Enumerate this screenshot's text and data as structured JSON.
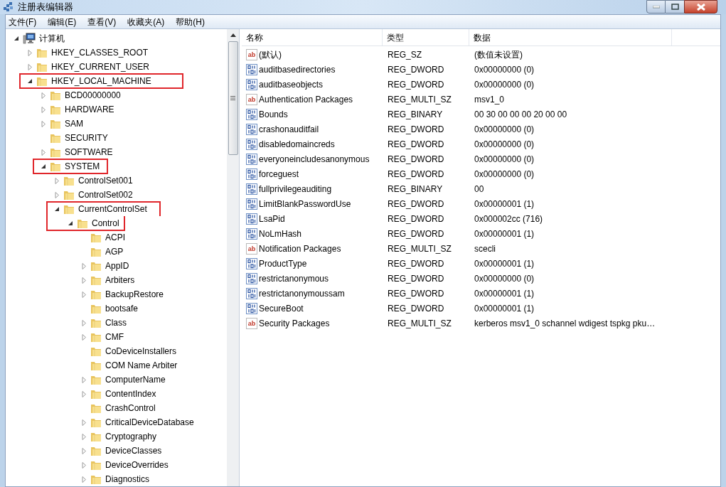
{
  "window": {
    "title": "注册表编辑器"
  },
  "menu": [
    "文件(F)",
    "编辑(E)",
    "查看(V)",
    "收藏夹(A)",
    "帮助(H)"
  ],
  "tree": [
    {
      "label": "计算机",
      "kind": "computer",
      "expandable": true,
      "expanded": true,
      "highlighted": false,
      "children": [
        {
          "label": "HKEY_CLASSES_ROOT",
          "expandable": true,
          "expanded": false,
          "highlighted": false
        },
        {
          "label": "HKEY_CURRENT_USER",
          "expandable": true,
          "expanded": false,
          "highlighted": false
        },
        {
          "label": "HKEY_LOCAL_MACHINE",
          "expandable": true,
          "expanded": true,
          "highlighted": true,
          "children": [
            {
              "label": "BCD00000000",
              "expandable": true,
              "expanded": false,
              "highlighted": false
            },
            {
              "label": "HARDWARE",
              "expandable": true,
              "expanded": false,
              "highlighted": false
            },
            {
              "label": "SAM",
              "expandable": true,
              "expanded": false,
              "highlighted": false
            },
            {
              "label": "SECURITY",
              "expandable": false,
              "expanded": false,
              "highlighted": false
            },
            {
              "label": "SOFTWARE",
              "expandable": true,
              "expanded": false,
              "highlighted": false
            },
            {
              "label": "SYSTEM",
              "expandable": true,
              "expanded": true,
              "highlighted": true,
              "children": [
                {
                  "label": "ControlSet001",
                  "expandable": true,
                  "expanded": false,
                  "highlighted": false
                },
                {
                  "label": "ControlSet002",
                  "expandable": true,
                  "expanded": false,
                  "highlighted": false
                },
                {
                  "label": "CurrentControlSet",
                  "expandable": true,
                  "expanded": true,
                  "highlighted": true,
                  "children": [
                    {
                      "label": "Control",
                      "expandable": true,
                      "expanded": true,
                      "highlighted": true,
                      "children": [
                        {
                          "label": "ACPI",
                          "expandable": false,
                          "expanded": false,
                          "highlighted": false
                        },
                        {
                          "label": "AGP",
                          "expandable": false,
                          "expanded": false,
                          "highlighted": false
                        },
                        {
                          "label": "AppID",
                          "expandable": true,
                          "expanded": false,
                          "highlighted": false
                        },
                        {
                          "label": "Arbiters",
                          "expandable": true,
                          "expanded": false,
                          "highlighted": false
                        },
                        {
                          "label": "BackupRestore",
                          "expandable": true,
                          "expanded": false,
                          "highlighted": false
                        },
                        {
                          "label": "bootsafe",
                          "expandable": false,
                          "expanded": false,
                          "highlighted": false
                        },
                        {
                          "label": "Class",
                          "expandable": true,
                          "expanded": false,
                          "highlighted": false
                        },
                        {
                          "label": "CMF",
                          "expandable": true,
                          "expanded": false,
                          "highlighted": false
                        },
                        {
                          "label": "CoDeviceInstallers",
                          "expandable": false,
                          "expanded": false,
                          "highlighted": false
                        },
                        {
                          "label": "COM Name Arbiter",
                          "expandable": false,
                          "expanded": false,
                          "highlighted": false
                        },
                        {
                          "label": "ComputerName",
                          "expandable": true,
                          "expanded": false,
                          "highlighted": false
                        },
                        {
                          "label": "ContentIndex",
                          "expandable": true,
                          "expanded": false,
                          "highlighted": false
                        },
                        {
                          "label": "CrashControl",
                          "expandable": false,
                          "expanded": false,
                          "highlighted": false
                        },
                        {
                          "label": "CriticalDeviceDatabase",
                          "expandable": true,
                          "expanded": false,
                          "highlighted": false
                        },
                        {
                          "label": "Cryptography",
                          "expandable": true,
                          "expanded": false,
                          "highlighted": false
                        },
                        {
                          "label": "DeviceClasses",
                          "expandable": true,
                          "expanded": false,
                          "highlighted": false
                        },
                        {
                          "label": "DeviceOverrides",
                          "expandable": true,
                          "expanded": false,
                          "highlighted": false
                        },
                        {
                          "label": "Diagnostics",
                          "expandable": true,
                          "expanded": false,
                          "highlighted": false
                        }
                      ]
                    }
                  ]
                }
              ]
            }
          ]
        }
      ]
    }
  ],
  "table": {
    "columns": [
      "名称",
      "类型",
      "数据"
    ],
    "rows": [
      {
        "kind": "string",
        "icon_label": "ab",
        "name": "(默认)",
        "type": "REG_SZ",
        "data": "(数值未设置)"
      },
      {
        "kind": "binary",
        "name": "auditbasedirectories",
        "type": "REG_DWORD",
        "data": "0x00000000 (0)"
      },
      {
        "kind": "binary",
        "name": "auditbaseobjects",
        "type": "REG_DWORD",
        "data": "0x00000000 (0)"
      },
      {
        "kind": "string",
        "icon_label": "ab",
        "name": "Authentication Packages",
        "type": "REG_MULTI_SZ",
        "data": "msv1_0"
      },
      {
        "kind": "binary",
        "name": "Bounds",
        "type": "REG_BINARY",
        "data": "00 30 00 00 00 20 00 00"
      },
      {
        "kind": "binary",
        "name": "crashonauditfail",
        "type": "REG_DWORD",
        "data": "0x00000000 (0)"
      },
      {
        "kind": "binary",
        "name": "disabledomaincreds",
        "type": "REG_DWORD",
        "data": "0x00000000 (0)"
      },
      {
        "kind": "binary",
        "name": "everyoneincludesanonymous",
        "type": "REG_DWORD",
        "data": "0x00000000 (0)"
      },
      {
        "kind": "binary",
        "name": "forceguest",
        "type": "REG_DWORD",
        "data": "0x00000000 (0)"
      },
      {
        "kind": "binary",
        "name": "fullprivilegeauditing",
        "type": "REG_BINARY",
        "data": "00"
      },
      {
        "kind": "binary",
        "name": "LimitBlankPasswordUse",
        "type": "REG_DWORD",
        "data": "0x00000001 (1)"
      },
      {
        "kind": "binary",
        "name": "LsaPid",
        "type": "REG_DWORD",
        "data": "0x000002cc (716)"
      },
      {
        "kind": "binary",
        "name": "NoLmHash",
        "type": "REG_DWORD",
        "data": "0x00000001 (1)"
      },
      {
        "kind": "string",
        "icon_label": "ab",
        "name": "Notification Packages",
        "type": "REG_MULTI_SZ",
        "data": "scecli"
      },
      {
        "kind": "binary",
        "name": "ProductType",
        "type": "REG_DWORD",
        "data": "0x00000001 (1)"
      },
      {
        "kind": "binary",
        "name": "restrictanonymous",
        "type": "REG_DWORD",
        "data": "0x00000000 (0)"
      },
      {
        "kind": "binary",
        "name": "restrictanonymoussam",
        "type": "REG_DWORD",
        "data": "0x00000001 (1)"
      },
      {
        "kind": "binary",
        "name": "SecureBoot",
        "type": "REG_DWORD",
        "data": "0x00000001 (1)"
      },
      {
        "kind": "string",
        "icon_label": "ab",
        "name": "Security Packages",
        "type": "REG_MULTI_SZ",
        "data": "kerberos msv1_0 schannel wdigest tspkg pku…"
      }
    ]
  }
}
